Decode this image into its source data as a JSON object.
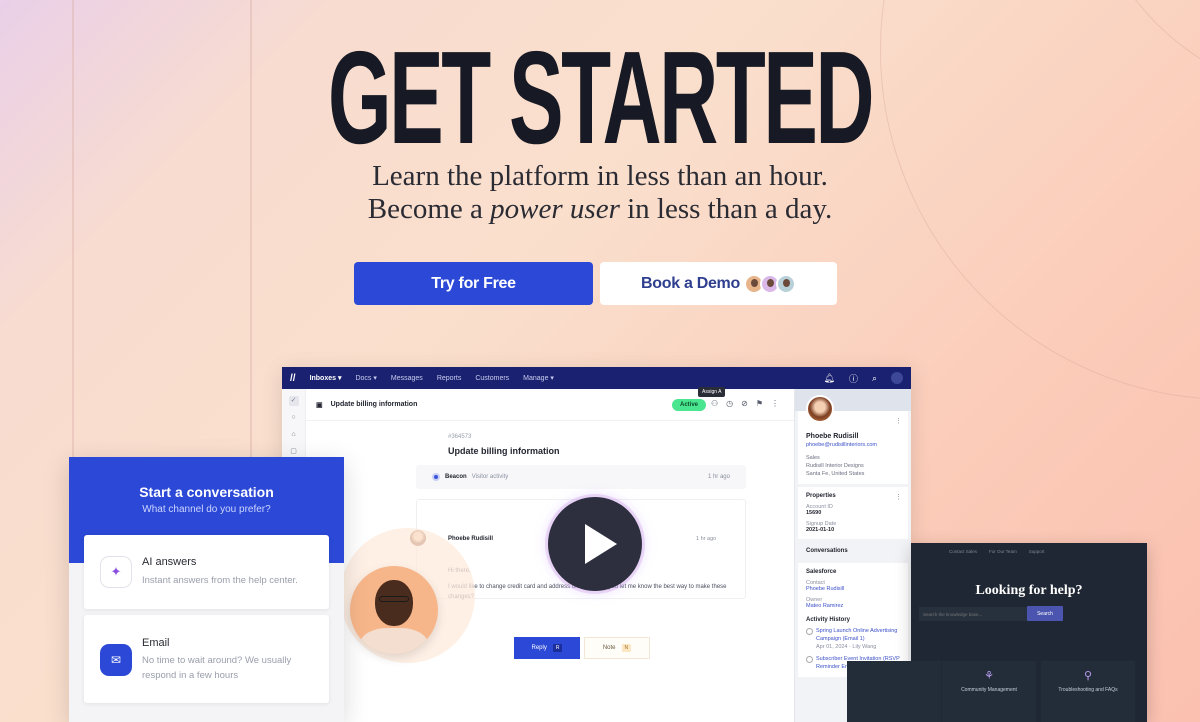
{
  "hero": {
    "title": "GET STARTED",
    "subtitle_line1": "Learn the platform in less than an hour.",
    "subtitle_line2_pre": "Become a ",
    "subtitle_line2_em": "power user",
    "subtitle_line2_post": " in less than a day."
  },
  "cta": {
    "try_label": "Try for Free",
    "demo_label": "Book a Demo"
  },
  "colors": {
    "brand_blue": "#2b48d6",
    "nav_navy": "#1a2170",
    "active_green": "#49e58f",
    "heading_dark": "#171a24"
  },
  "app": {
    "nav": {
      "logo": "//",
      "items": [
        "Inboxes ▾",
        "Docs ▾",
        "Messages",
        "Reports",
        "Customers",
        "Manage ▾"
      ],
      "icons": [
        "bell-icon",
        "help-icon",
        "search-icon",
        "avatar"
      ]
    },
    "conversation": {
      "header_title": "Update billing information",
      "status": "Active",
      "tooltip": "Assign",
      "tooltip_key": "A",
      "ticket_number": "#364573",
      "title": "Update billing information",
      "beacon": {
        "source": "Beacon",
        "label": "Visitor activity",
        "time": "1 hr ago"
      },
      "message": {
        "author": "Phoebe Rudisill",
        "time": "1 hr ago",
        "greeting": "Hi there,",
        "body": "I would like to change credit card and address on file. Could you let me know the best way to make these changes?"
      },
      "reply_label": "Reply",
      "reply_key": "R",
      "note_label": "Note",
      "note_key": "N"
    },
    "customer": {
      "name": "Phoebe Rudisill",
      "email": "phoebe@rudisillinteriors.com",
      "role": "Sales",
      "company": "Rudisill Interior Designs",
      "location": "Santa Fe, United States",
      "properties_title": "Properties",
      "properties": [
        {
          "label": "Account ID",
          "value": "15690"
        },
        {
          "label": "Signup Date",
          "value": "2021-01-10"
        }
      ],
      "conversations_title": "Conversations",
      "salesforce_title": "Salesforce",
      "contact_label": "Contact",
      "contact_value": "Phoebe Rudisill",
      "owner_label": "Owner",
      "owner_value": "Mateo Ramirez",
      "activity_title": "Activity History",
      "activity": [
        {
          "title": "Spring Launch Online Advertising Campaign (Email 1)",
          "meta": "Apr 01, 2024 · Lily Wang"
        },
        {
          "title": "Subscriber Event Invitation (RSVP Reminder Email)",
          "meta": ""
        }
      ]
    }
  },
  "widget": {
    "title": "Start a conversation",
    "subtitle": "What channel do you prefer?",
    "options": [
      {
        "title": "AI answers",
        "desc": "Instant answers from the help center.",
        "icon": "sparkle-icon"
      },
      {
        "title": "Email",
        "desc": "No time to wait around? We usually respond in a few hours",
        "icon": "mail-icon"
      }
    ]
  },
  "help_center": {
    "nav": [
      "Contact Sales",
      "For Our Team",
      "Support"
    ],
    "title": "Looking for help?",
    "search_placeholder": "Search the knowledge base...",
    "search_button": "Search",
    "tiles": [
      "Community Management",
      "Troubleshooting and FAQs"
    ]
  }
}
